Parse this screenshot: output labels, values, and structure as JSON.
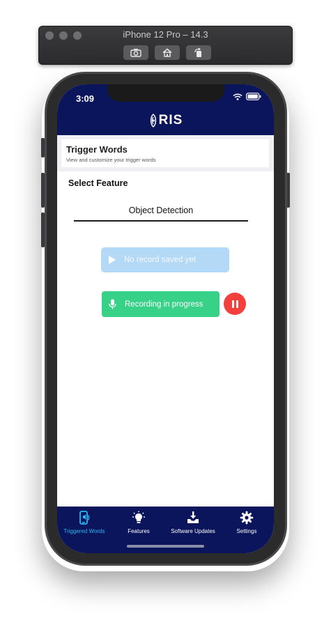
{
  "simulator": {
    "title": "iPhone 12 Pro – 14.3",
    "buttons": [
      "camera-icon",
      "home-icon",
      "rotate-icon"
    ]
  },
  "status_bar": {
    "time": "3:09"
  },
  "header": {
    "logo_text": "RIS"
  },
  "page": {
    "title": "Trigger Words",
    "subtitle": "View and customize your trigger words"
  },
  "feature": {
    "label": "Select Feature",
    "selected": "Object Detection"
  },
  "playback": {
    "label": "No record saved yet",
    "icon": "play-icon"
  },
  "recording": {
    "label": "Recording in progress",
    "icon": "microphone-icon",
    "pause_icon": "pause-icon"
  },
  "tabs": [
    {
      "label": "Triggered Words",
      "icon": "phone-audio-icon",
      "active": true
    },
    {
      "label": "Features",
      "icon": "lightbulb-icon",
      "active": false
    },
    {
      "label": "Software Updates",
      "icon": "download-icon",
      "active": false
    },
    {
      "label": "Settings",
      "icon": "gear-icon",
      "active": false
    }
  ],
  "colors": {
    "navy": "#0b155b",
    "active_tab": "#27b6f2",
    "play_button": "#b4d9f6",
    "record_button": "#37d187",
    "pause_button": "#f2413d"
  }
}
